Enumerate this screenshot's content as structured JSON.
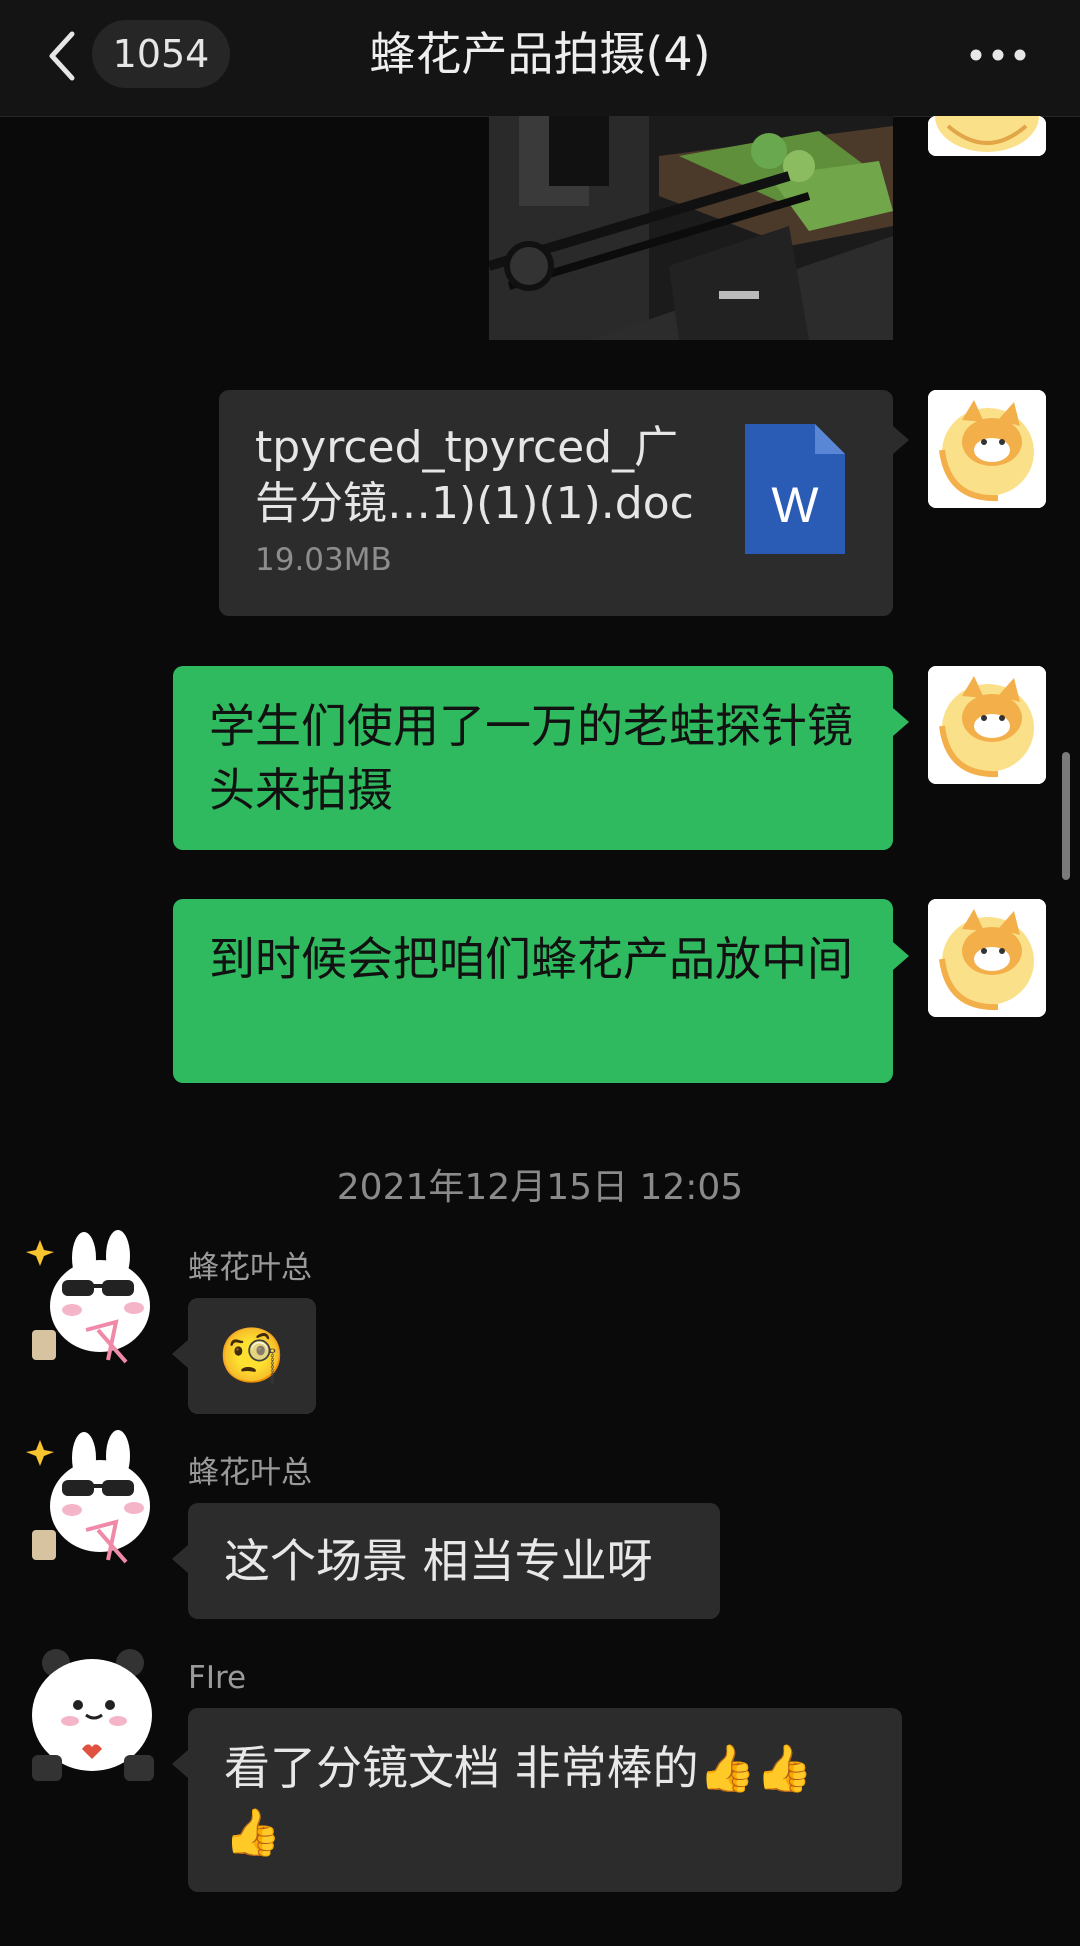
{
  "header": {
    "unread_count": "1054",
    "title": "蜂花产品拍摄(4)"
  },
  "messages": {
    "file": {
      "name": "tpyrced_tpyrced_广告分镜…1)(1)(1).doc",
      "size": "19.03MB"
    },
    "text1": "学生们使用了一万的老蛙探针镜头来拍摄",
    "text2": "到时候会把咱们蜂花产品放中间",
    "timestamp": "2021年12月15日 12:05",
    "incoming": [
      {
        "sender": "蜂花叶总",
        "text": "🧐"
      },
      {
        "sender": "蜂花叶总",
        "text": "这个场景 相当专业呀"
      },
      {
        "sender": "FIre",
        "text": "看了分镜文档  非常棒的👍👍👍"
      }
    ]
  },
  "icons": {
    "back": "chevron-left-icon",
    "more": "more-dots-icon",
    "file_type": "word-doc-icon"
  },
  "colors": {
    "green_bubble": "#2fba5f",
    "grey_bubble": "#2c2c2c",
    "word_blue": "#2b5cb5"
  }
}
